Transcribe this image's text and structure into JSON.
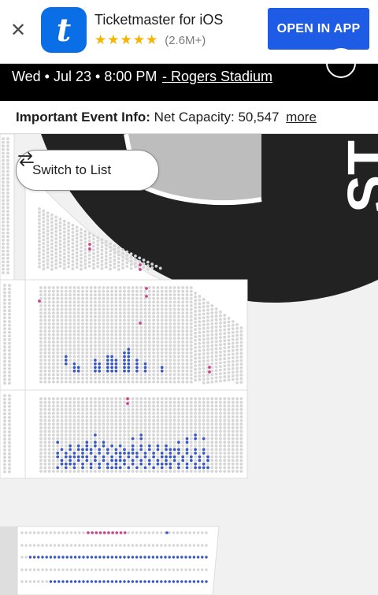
{
  "banner": {
    "close_icon": "close-icon",
    "logo_letter": "t",
    "app_name": "Ticketmaster for iOS",
    "stars": "★★★★★",
    "rating_count": "(2.6M+)",
    "open_button": "OPEN IN APP",
    "brand_color": "#0a6ee6",
    "button_color": "#1e5ce6"
  },
  "event": {
    "date_time": "Wed • Jul 23 • 8:00 PM",
    "venue": " - Rogers Stadium"
  },
  "info": {
    "label": "Important Event Info:",
    "text": " Net Capacity: 50,547",
    "more": "more"
  },
  "map": {
    "stage_text": "ST",
    "switch_button": "Switch to List",
    "switch_icon": "swap-arrows-icon",
    "available_color": "#3a58c4",
    "resale_color": "#c8478a",
    "unavailable_color": "#d6d6d6"
  }
}
